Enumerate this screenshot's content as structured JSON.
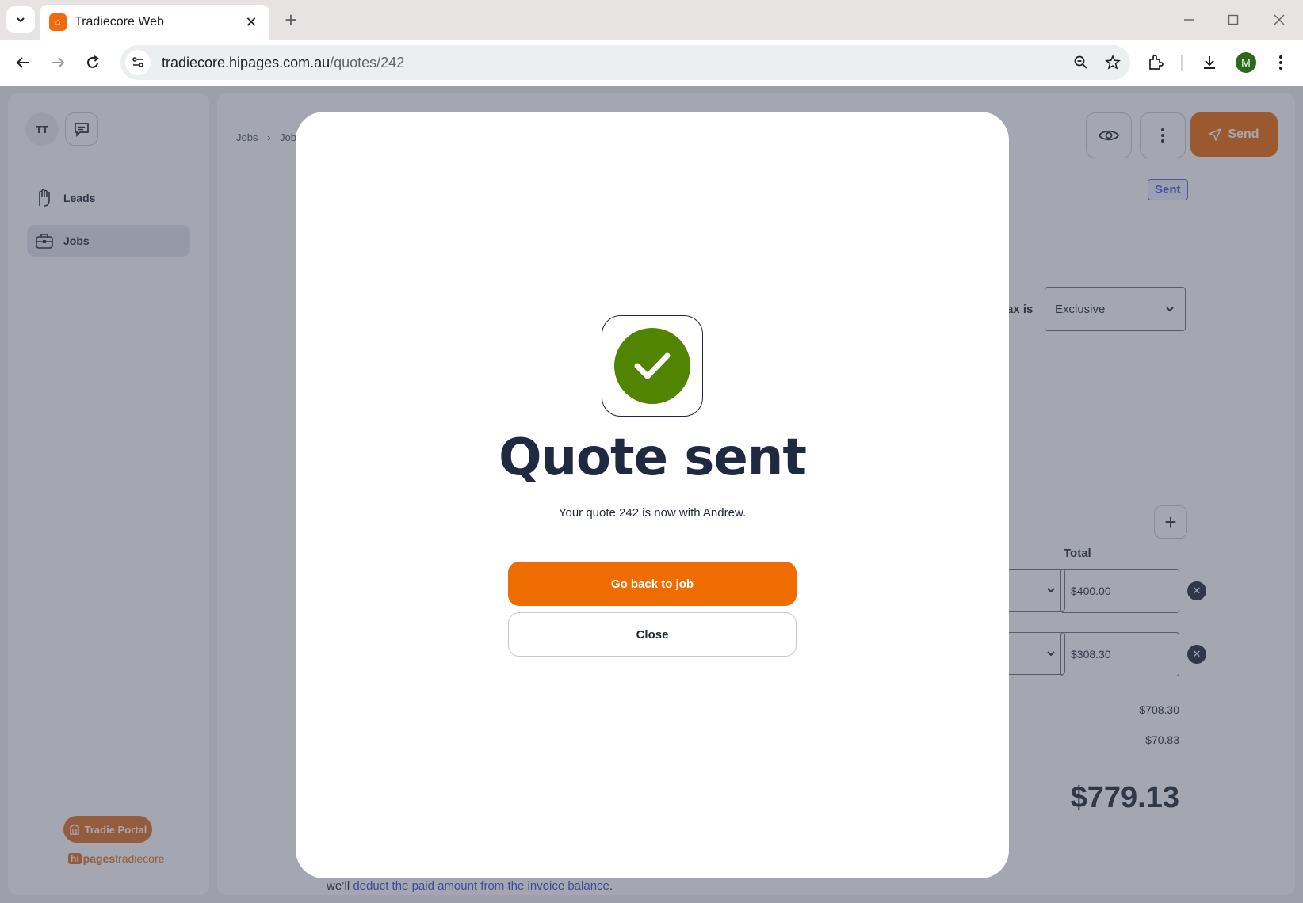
{
  "browser": {
    "tab_title": "Tradiecore Web",
    "url_host": "tradiecore.hipages.com.au",
    "url_path": "/quotes/242",
    "profile_initial": "M"
  },
  "sidebar": {
    "avatar_initials": "TT",
    "items": [
      {
        "label": "Leads",
        "icon": "hand-icon",
        "active": false
      },
      {
        "label": "Jobs",
        "icon": "briefcase-icon",
        "active": true
      }
    ],
    "tradie_portal_label": "Tradie Portal",
    "brand_hi": "hi",
    "brand_pages": "pages",
    "brand_tradiecore": "tradiecore"
  },
  "main": {
    "breadcrumb": [
      "Jobs",
      "Job"
    ],
    "send_label": "Send",
    "status_badge": "Sent",
    "tax_label": "ax is",
    "tax_mode": "Exclusive",
    "total_header": "Total",
    "line_items": [
      {
        "total": "$400.00"
      },
      {
        "total": "$308.30"
      }
    ],
    "subtotal": "$708.30",
    "tax": "$70.83",
    "grand_total": "$779.13",
    "footnote_prefix": "we’ll ",
    "footnote_link": "deduct the paid amount from the invoice balance",
    "footnote_suffix": "."
  },
  "modal": {
    "title": "Quote sent",
    "message": "Your quote 242 is now with Andrew.",
    "primary_label": "Go back to job",
    "secondary_label": "Close"
  },
  "colors": {
    "accent_orange": "#ef6c00",
    "success_green": "#518400",
    "status_blue": "#4a5bd3"
  }
}
